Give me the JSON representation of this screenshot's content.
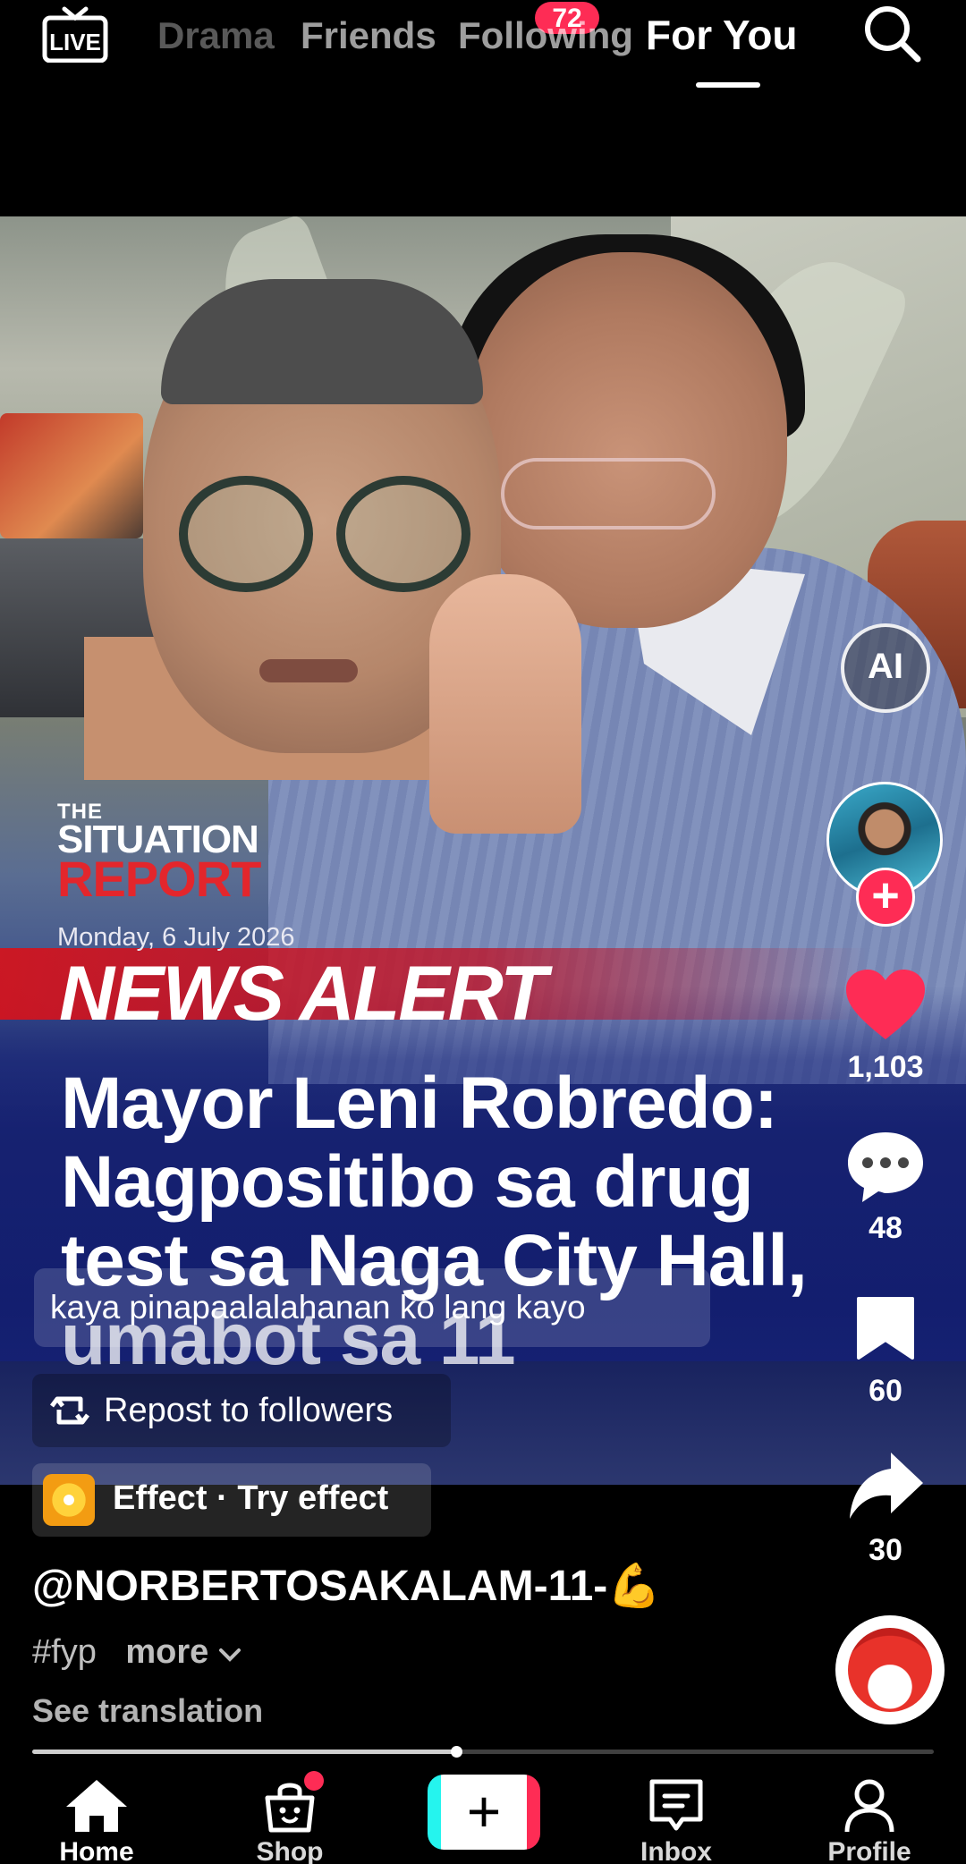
{
  "top_nav": {
    "live_label": "LIVE",
    "tabs": [
      "Drama",
      "Friends",
      "Following",
      "For You"
    ],
    "active_tab": "For You",
    "friends_badge": "72"
  },
  "video": {
    "logo": {
      "line1": "THE",
      "line2": "SITUATION",
      "line3": "REPORT"
    },
    "date": "Monday, 6 July 2026",
    "alert": "NEWS ALERT",
    "headline_lines": [
      "Mayor Leni Robredo:",
      "Nagpositibo sa drug",
      "test sa Naga City Hall,",
      "umabot sa 11"
    ],
    "caption": "kaya pinapaalalahanan ko lang kayo"
  },
  "actions": {
    "ai_label": "AI",
    "likes": "1,103",
    "comments": "48",
    "saves": "60",
    "shares": "30"
  },
  "repost_label": "Repost to followers",
  "effect_label": "Effect · Try effect",
  "username": "@NORBERTOSAKALAM-11-💪",
  "hashtags": "#fyp",
  "more_label": "more",
  "see_translation": "See translation",
  "progress_fraction": 0.47,
  "bottom_nav": {
    "items": [
      {
        "label": "Home",
        "icon": "home-icon"
      },
      {
        "label": "Shop",
        "icon": "shopping-bag-icon"
      },
      {
        "label": "",
        "icon": "create-icon"
      },
      {
        "label": "Inbox",
        "icon": "inbox-icon"
      },
      {
        "label": "Profile",
        "icon": "profile-icon"
      }
    ],
    "active": "Home"
  },
  "colors": {
    "accent": "#fe2c55",
    "like": "#fe2c55",
    "background": "#000000"
  }
}
